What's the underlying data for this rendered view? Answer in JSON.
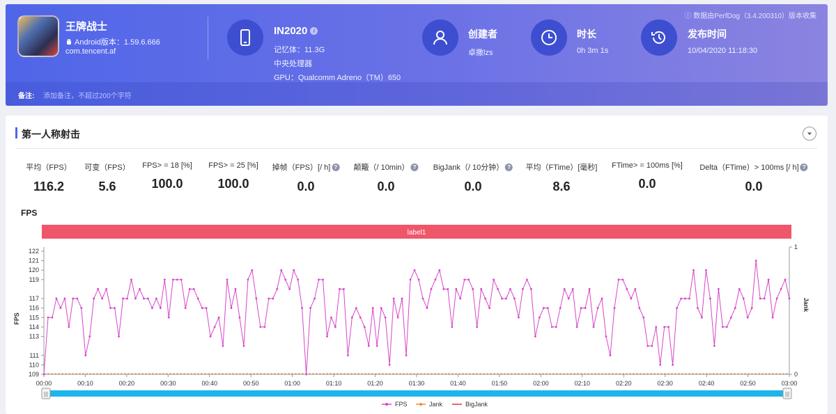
{
  "header": {
    "source_note": "数据由PerfDog（3.4.200310）版本收集",
    "app": {
      "name": "王牌战士",
      "android_version": "Android版本：1.59.6.666",
      "package": "com.tencent.af"
    },
    "device": {
      "name": "IN2020",
      "memory": "记忆体：11.3G",
      "cpu": "中央处理器",
      "gpu": "GPU：Qualcomm Adreno（TM）650"
    },
    "creator": {
      "title": "创建者",
      "value": "卓撒lzs"
    },
    "duration": {
      "title": "时长",
      "value": "0h 3m 1s"
    },
    "publish": {
      "title": "发布时间",
      "value": "10/04/2020 11:18:30"
    },
    "note": {
      "label": "备注:",
      "placeholder": "添加备注，不超过200个字符"
    },
    "icons": [
      "android-icon",
      "phone-icon",
      "user-icon",
      "clock-icon",
      "history-icon"
    ]
  },
  "section": {
    "title": "第一人称射击"
  },
  "metrics": [
    {
      "label": "平均（FPS）",
      "value": "116.2",
      "help": false
    },
    {
      "label": "可变（FPS）",
      "value": "5.6",
      "help": false
    },
    {
      "label": "FPS> = 18 [%]",
      "value": "100.0",
      "help": false
    },
    {
      "label": "FPS> = 25 [%]",
      "value": "100.0",
      "help": false
    },
    {
      "label": "掉帧（FPS）[/ h]",
      "value": "0.0",
      "help": true
    },
    {
      "label": "颠簸（/ 10min）",
      "value": "0.0",
      "help": true
    },
    {
      "label": "BigJank（/ 10分钟）",
      "value": "0.0",
      "help": true
    },
    {
      "label": "平均（FTime）[毫秒]",
      "value": "8.6",
      "help": false
    },
    {
      "label": "FTime> = 100ms [%]",
      "value": "0.0",
      "help": false
    },
    {
      "label": "Delta（FTime）> 100ms [/ h]",
      "value": "0.0",
      "help": true
    }
  ],
  "colors": {
    "accent": "#4f66e8",
    "fps_line": "#d845c9",
    "jank": "#f08a3c",
    "bigjank": "#e8333b",
    "label_bar": "#f0566a",
    "slider": "#1eb4ec"
  },
  "chart_data": {
    "type": "line",
    "title": "FPS",
    "ylabel": "FPS",
    "y2label": "Jank",
    "band_label": "label1",
    "ylim": [
      109,
      122
    ],
    "y2lim": [
      0,
      1
    ],
    "yticks": [
      109,
      110,
      111,
      113,
      114,
      115,
      116,
      117,
      119,
      120,
      121,
      122
    ],
    "y2ticks": [
      0,
      1
    ],
    "xlim": [
      0,
      180
    ],
    "xticks": [
      "00:00",
      "00:10",
      "00:20",
      "00:30",
      "00:40",
      "00:50",
      "01:00",
      "01:10",
      "01:20",
      "01:30",
      "01:40",
      "01:50",
      "02:00",
      "02:10",
      "02:20",
      "02:30",
      "02:40",
      "02:50",
      "03:00"
    ],
    "legend": [
      "FPS",
      "Jank",
      "BigJank"
    ],
    "legend_position": "bottom",
    "series": [
      {
        "name": "FPS",
        "axis": "left",
        "values": [
          109,
          115,
          115,
          117,
          116,
          117,
          114,
          117,
          117,
          116,
          111,
          113,
          117,
          118,
          117,
          118,
          116,
          116,
          113,
          117,
          117,
          119,
          117,
          118,
          117,
          117,
          116,
          117,
          116,
          119,
          115,
          119,
          119,
          119,
          116,
          118,
          118,
          117,
          116,
          116,
          113,
          114,
          115,
          112,
          119,
          116,
          118,
          115,
          112,
          119,
          120,
          117,
          114,
          114,
          117,
          117,
          118,
          120,
          119,
          118,
          120,
          119,
          116,
          109,
          116,
          117,
          119,
          119,
          113,
          115,
          114,
          118,
          118,
          111,
          115,
          116,
          115,
          114,
          112,
          116,
          112,
          116,
          115,
          110,
          117,
          115,
          117,
          111,
          119,
          120,
          119,
          117,
          116,
          118,
          119,
          120,
          118,
          118,
          114,
          118,
          117,
          119,
          119,
          118,
          114,
          118,
          117,
          116,
          119,
          118,
          117,
          117,
          118,
          117,
          115,
          118,
          119,
          118,
          113,
          115,
          116,
          116,
          114,
          114,
          116,
          118,
          117,
          118,
          114,
          116,
          116,
          118,
          114,
          116,
          117,
          113,
          111,
          116,
          119,
          119,
          118,
          117,
          118,
          116,
          115,
          112,
          112,
          114,
          110,
          114,
          114,
          110,
          116,
          117,
          117,
          117,
          120,
          116,
          115,
          120,
          117,
          112,
          118,
          114,
          114,
          115,
          116,
          118,
          117,
          115,
          116,
          121,
          117,
          117,
          119,
          115,
          117,
          118,
          119,
          117
        ]
      },
      {
        "name": "Jank",
        "axis": "right",
        "values": "all 0"
      },
      {
        "name": "BigJank",
        "axis": "right",
        "values": "all 0"
      }
    ]
  }
}
